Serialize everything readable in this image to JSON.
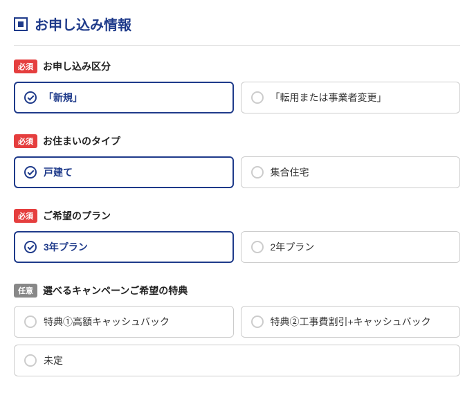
{
  "header": {
    "title": "お申し込み情報"
  },
  "badges": {
    "required": "必須",
    "optional": "任意"
  },
  "fields": {
    "application_type": {
      "label": "お申し込み区分",
      "options": {
        "new": "「新規」",
        "transfer": "「転用または事業者変更」"
      }
    },
    "residence_type": {
      "label": "お住まいのタイプ",
      "options": {
        "house": "戸建て",
        "apartment": "集合住宅"
      }
    },
    "plan": {
      "label": "ご希望のプラン",
      "options": {
        "three_year": "3年プラン",
        "two_year": "2年プラン"
      }
    },
    "campaign": {
      "label": "選べるキャンペーンご希望の特典",
      "options": {
        "cashback": "特典①高額キャッシュバック",
        "discount": "特典②工事費割引+キャッシュバック",
        "undecided": "未定"
      }
    }
  }
}
